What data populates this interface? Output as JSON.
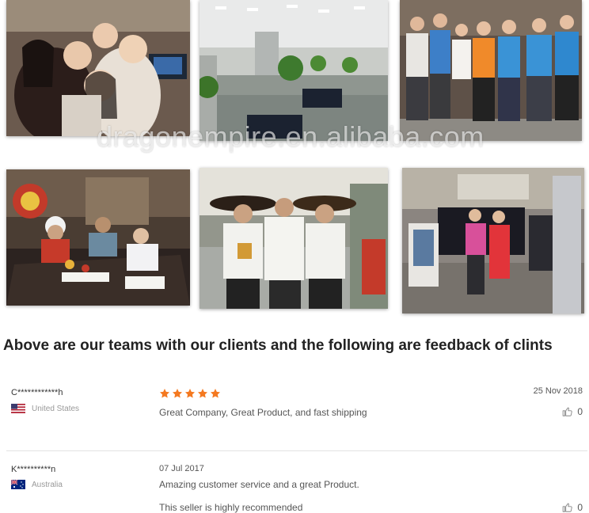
{
  "watermark": "dragonempire.en.alibaba.com",
  "headline": "Above are our teams with our clients and the following are feedback of clints",
  "reviews": [
    {
      "name": "C************h",
      "country": "United States",
      "date": "25 Nov 2018",
      "rating": 5,
      "text": "Great Company, Great Product, and fast shipping",
      "likes": "0"
    },
    {
      "name": "K**********n",
      "country": "Australia",
      "date": "07 Jul 2017",
      "text": "Amazing customer service and a great Product.",
      "text2": "This seller is highly recommended",
      "likes": "0"
    }
  ],
  "colors": {
    "star": "#f47920",
    "divider": "#e3e3e3",
    "text": "#555555"
  },
  "icons": [
    "star-icon",
    "thumbs-up-icon",
    "us-flag-icon",
    "australia-flag-icon"
  ]
}
